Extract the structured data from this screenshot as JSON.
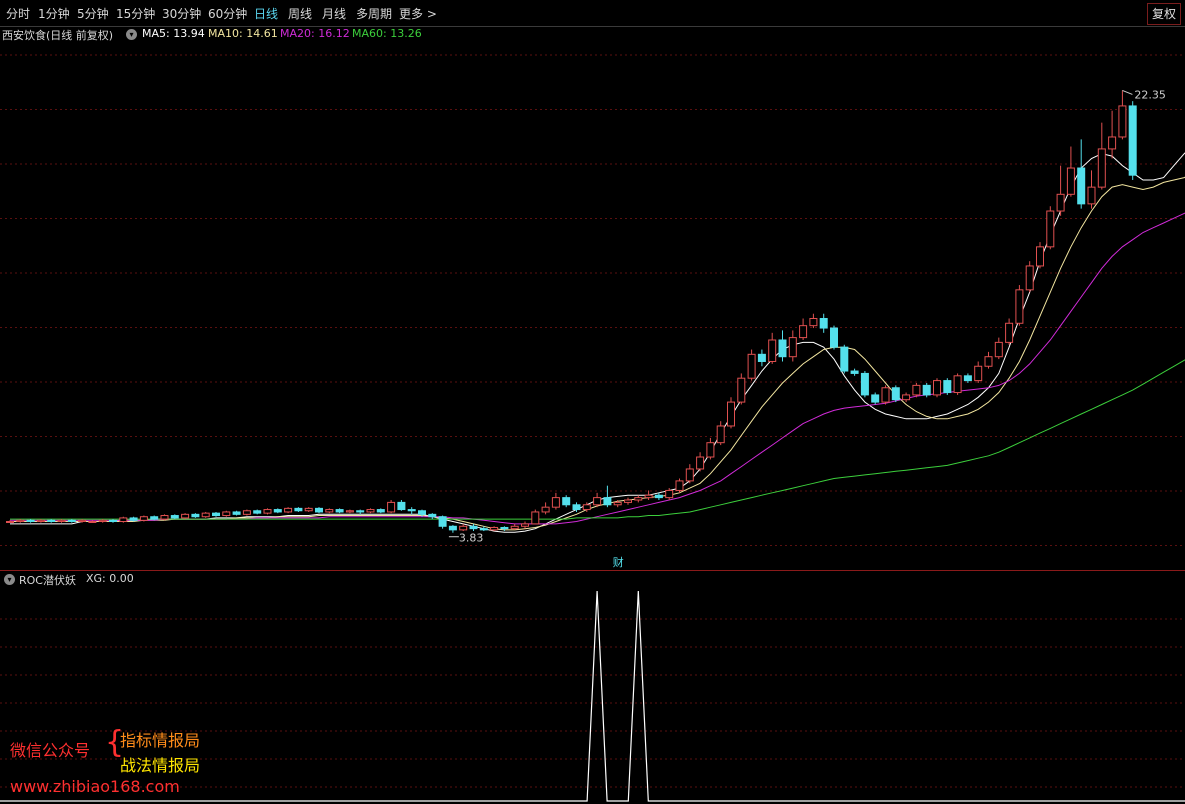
{
  "toolbar": {
    "tabs": [
      "分时",
      "1分钟",
      "5分钟",
      "15分钟",
      "30分钟",
      "60分钟",
      "日线",
      "周线",
      "月线",
      "多周期",
      "更多 >"
    ],
    "active_tab": "日线",
    "restore_label": "复权"
  },
  "infobar": {
    "stock": "西安饮食(日线 前复权)",
    "ma5": "MA5: 13.94",
    "ma10": "MA10: 14.61",
    "ma20": "MA20: 16.12",
    "ma60": "MA60: 13.26"
  },
  "colors": {
    "up": "#e05050",
    "down": "#54e0ec",
    "ma5": "#ffffff",
    "ma10": "#f3e6a0",
    "ma20": "#d02bd8",
    "ma60": "#3ccf3c",
    "grid": "#5a1010",
    "active_tab": "#5ad6f0"
  },
  "chart_data": {
    "type": "candlestick",
    "price_range": [
      3.4,
      24.0
    ],
    "high_label": "22.35",
    "low_label": "3.83",
    "event_marker": "财",
    "series": [
      {
        "name": "MA5",
        "values": [
          4.2,
          4.2,
          4.2,
          4.2,
          4.2,
          4.2,
          4.2,
          4.3,
          4.3,
          4.3,
          4.3,
          4.35,
          4.35,
          4.35,
          4.4,
          4.4,
          4.4,
          4.4,
          4.4,
          4.4,
          4.45,
          4.45,
          4.45,
          4.5,
          4.5,
          4.5,
          4.5,
          4.55,
          4.55,
          4.55,
          4.6,
          4.6,
          4.6,
          4.6,
          4.6,
          4.6,
          4.6,
          4.6,
          4.6,
          4.6,
          4.6,
          4.5,
          4.4,
          4.3,
          4.2,
          4.1,
          4.0,
          3.9,
          3.85,
          3.85,
          3.9,
          4.0,
          4.2,
          4.4,
          4.6,
          4.8,
          5.0,
          5.2,
          5.3,
          5.35,
          5.4,
          5.4,
          5.4,
          5.5,
          5.6,
          5.7,
          6.0,
          6.5,
          7.2,
          8.0,
          8.7,
          9.4,
          10.0,
          10.6,
          11.1,
          11.5,
          11.7,
          11.8,
          11.8,
          11.6,
          11.1,
          10.4,
          9.8,
          9.3,
          9.0,
          8.8,
          8.7,
          8.6,
          8.6,
          8.6,
          8.7,
          8.8,
          9.0,
          9.2,
          9.5,
          9.9,
          10.5,
          11.6,
          12.8,
          13.9,
          15.2,
          16.3,
          17.3,
          18.3,
          19.1,
          19.5,
          19.7,
          19.6,
          19.2,
          18.9,
          18.6,
          18.6,
          18.7,
          19.2,
          19.7,
          20.1
        ]
      },
      {
        "name": "MA10",
        "values": [
          4.3,
          4.3,
          4.3,
          4.3,
          4.3,
          4.3,
          4.3,
          4.3,
          4.3,
          4.3,
          4.3,
          4.3,
          4.3,
          4.35,
          4.35,
          4.35,
          4.4,
          4.4,
          4.4,
          4.4,
          4.4,
          4.4,
          4.45,
          4.45,
          4.45,
          4.45,
          4.5,
          4.5,
          4.5,
          4.5,
          4.55,
          4.55,
          4.55,
          4.55,
          4.55,
          4.55,
          4.55,
          4.55,
          4.55,
          4.55,
          4.55,
          4.5,
          4.45,
          4.4,
          4.3,
          4.2,
          4.1,
          4.0,
          3.95,
          3.95,
          4.0,
          4.05,
          4.15,
          4.3,
          4.45,
          4.6,
          4.8,
          4.95,
          5.05,
          5.15,
          5.2,
          5.25,
          5.3,
          5.35,
          5.4,
          5.5,
          5.7,
          5.9,
          6.3,
          6.8,
          7.3,
          7.9,
          8.5,
          9.1,
          9.6,
          10.1,
          10.5,
          10.9,
          11.2,
          11.5,
          11.6,
          11.6,
          11.5,
          11.1,
          10.6,
          10.1,
          9.6,
          9.2,
          8.9,
          8.7,
          8.6,
          8.6,
          8.7,
          8.8,
          9.0,
          9.3,
          9.7,
          10.3,
          11.0,
          11.9,
          12.9,
          13.9,
          14.9,
          15.8,
          16.6,
          17.3,
          17.9,
          18.3,
          18.4,
          18.3,
          18.2,
          18.3,
          18.5,
          18.6,
          18.7,
          18.9
        ]
      },
      {
        "name": "MA20",
        "values": [
          4.35,
          4.35,
          4.35,
          4.35,
          4.35,
          4.35,
          4.35,
          4.35,
          4.35,
          4.35,
          4.35,
          4.35,
          4.35,
          4.35,
          4.35,
          4.4,
          4.4,
          4.4,
          4.4,
          4.4,
          4.4,
          4.4,
          4.4,
          4.4,
          4.45,
          4.45,
          4.45,
          4.45,
          4.45,
          4.45,
          4.45,
          4.5,
          4.5,
          4.5,
          4.5,
          4.5,
          4.5,
          4.5,
          4.5,
          4.5,
          4.5,
          4.5,
          4.5,
          4.45,
          4.45,
          4.4,
          4.35,
          4.3,
          4.25,
          4.2,
          4.2,
          4.2,
          4.2,
          4.2,
          4.25,
          4.3,
          4.4,
          4.5,
          4.6,
          4.7,
          4.8,
          4.9,
          5.0,
          5.1,
          5.2,
          5.3,
          5.45,
          5.6,
          5.8,
          6.0,
          6.3,
          6.6,
          6.9,
          7.2,
          7.5,
          7.8,
          8.1,
          8.4,
          8.6,
          8.8,
          8.95,
          9.05,
          9.1,
          9.15,
          9.2,
          9.25,
          9.35,
          9.45,
          9.55,
          9.6,
          9.65,
          9.7,
          9.75,
          9.8,
          9.85,
          9.9,
          10.0,
          10.2,
          10.5,
          10.9,
          11.4,
          11.9,
          12.5,
          13.1,
          13.7,
          14.3,
          14.9,
          15.4,
          15.8,
          16.1,
          16.4,
          16.6,
          16.8,
          17.0,
          17.2,
          17.4
        ]
      },
      {
        "name": "MA60",
        "values": [
          4.4,
          4.4,
          4.4,
          4.4,
          4.4,
          4.4,
          4.4,
          4.4,
          4.4,
          4.4,
          4.4,
          4.4,
          4.4,
          4.4,
          4.4,
          4.4,
          4.4,
          4.4,
          4.4,
          4.4,
          4.4,
          4.4,
          4.4,
          4.4,
          4.4,
          4.4,
          4.4,
          4.4,
          4.4,
          4.4,
          4.4,
          4.4,
          4.4,
          4.4,
          4.4,
          4.4,
          4.4,
          4.4,
          4.4,
          4.4,
          4.4,
          4.4,
          4.4,
          4.4,
          4.4,
          4.4,
          4.4,
          4.4,
          4.4,
          4.4,
          4.4,
          4.4,
          4.4,
          4.4,
          4.4,
          4.45,
          4.45,
          4.45,
          4.45,
          4.45,
          4.5,
          4.5,
          4.55,
          4.55,
          4.6,
          4.65,
          4.7,
          4.8,
          4.9,
          5.0,
          5.1,
          5.2,
          5.3,
          5.4,
          5.5,
          5.6,
          5.7,
          5.8,
          5.9,
          6.0,
          6.1,
          6.15,
          6.2,
          6.25,
          6.3,
          6.35,
          6.4,
          6.45,
          6.5,
          6.55,
          6.6,
          6.65,
          6.75,
          6.85,
          6.95,
          7.05,
          7.2,
          7.4,
          7.6,
          7.8,
          8.0,
          8.2,
          8.4,
          8.6,
          8.8,
          9.0,
          9.2,
          9.4,
          9.6,
          9.8,
          10.05,
          10.3,
          10.55,
          10.8,
          11.05,
          11.3
        ]
      }
    ],
    "candles": [
      [
        4.3,
        4.3,
        4.35,
        4.25
      ],
      [
        4.3,
        4.35,
        4.4,
        4.25
      ],
      [
        4.35,
        4.3,
        4.4,
        4.25
      ],
      [
        4.3,
        4.35,
        4.4,
        4.25
      ],
      [
        4.35,
        4.3,
        4.4,
        4.25
      ],
      [
        4.3,
        4.35,
        4.4,
        4.25
      ],
      [
        4.35,
        4.3,
        4.4,
        4.25
      ],
      [
        4.3,
        4.35,
        4.4,
        4.25
      ],
      [
        4.3,
        4.3,
        4.35,
        4.25
      ],
      [
        4.3,
        4.35,
        4.4,
        4.25
      ],
      [
        4.35,
        4.3,
        4.4,
        4.25
      ],
      [
        4.3,
        4.45,
        4.5,
        4.25
      ],
      [
        4.45,
        4.35,
        4.5,
        4.3
      ],
      [
        4.35,
        4.5,
        4.55,
        4.3
      ],
      [
        4.5,
        4.4,
        4.55,
        4.35
      ],
      [
        4.4,
        4.55,
        4.6,
        4.35
      ],
      [
        4.55,
        4.45,
        4.6,
        4.4
      ],
      [
        4.45,
        4.6,
        4.65,
        4.4
      ],
      [
        4.6,
        4.5,
        4.65,
        4.45
      ],
      [
        4.5,
        4.65,
        4.7,
        4.45
      ],
      [
        4.65,
        4.55,
        4.7,
        4.5
      ],
      [
        4.55,
        4.7,
        4.75,
        4.5
      ],
      [
        4.7,
        4.6,
        4.75,
        4.55
      ],
      [
        4.6,
        4.75,
        4.8,
        4.55
      ],
      [
        4.75,
        4.65,
        4.8,
        4.6
      ],
      [
        4.65,
        4.8,
        4.85,
        4.6
      ],
      [
        4.8,
        4.7,
        4.85,
        4.65
      ],
      [
        4.7,
        4.85,
        4.9,
        4.65
      ],
      [
        4.85,
        4.75,
        4.9,
        4.7
      ],
      [
        4.75,
        4.85,
        4.9,
        4.7
      ],
      [
        4.85,
        4.7,
        4.9,
        4.65
      ],
      [
        4.7,
        4.8,
        4.85,
        4.65
      ],
      [
        4.8,
        4.7,
        4.85,
        4.65
      ],
      [
        4.7,
        4.75,
        4.8,
        4.65
      ],
      [
        4.75,
        4.7,
        4.8,
        4.6
      ],
      [
        4.7,
        4.8,
        4.85,
        4.65
      ],
      [
        4.8,
        4.7,
        4.85,
        4.65
      ],
      [
        4.7,
        5.1,
        5.2,
        4.65
      ],
      [
        5.1,
        4.8,
        5.2,
        4.75
      ],
      [
        4.8,
        4.75,
        4.9,
        4.6
      ],
      [
        4.75,
        4.6,
        4.8,
        4.5
      ],
      [
        4.6,
        4.5,
        4.65,
        4.4
      ],
      [
        4.5,
        4.1,
        4.55,
        4.0
      ],
      [
        4.1,
        3.95,
        4.15,
        3.83
      ],
      [
        3.95,
        4.1,
        4.2,
        3.9
      ],
      [
        4.1,
        4.0,
        4.2,
        3.9
      ],
      [
        4.0,
        3.95,
        4.1,
        3.9
      ],
      [
        3.95,
        4.05,
        4.1,
        3.9
      ],
      [
        4.05,
        4.0,
        4.1,
        3.9
      ],
      [
        4.0,
        4.1,
        4.2,
        3.95
      ],
      [
        4.1,
        4.2,
        4.3,
        4.0
      ],
      [
        4.2,
        4.7,
        4.8,
        4.2
      ],
      [
        4.7,
        4.9,
        5.1,
        4.6
      ],
      [
        4.9,
        5.3,
        5.5,
        4.8
      ],
      [
        5.3,
        5.0,
        5.4,
        4.9
      ],
      [
        5.0,
        4.8,
        5.1,
        4.7
      ],
      [
        4.8,
        5.0,
        5.1,
        4.7
      ],
      [
        5.0,
        5.3,
        5.5,
        4.9
      ],
      [
        5.3,
        5.0,
        5.8,
        4.9
      ],
      [
        5.0,
        5.1,
        5.2,
        4.9
      ],
      [
        5.1,
        5.2,
        5.3,
        5.0
      ],
      [
        5.2,
        5.3,
        5.4,
        5.1
      ],
      [
        5.3,
        5.4,
        5.6,
        5.2
      ],
      [
        5.4,
        5.3,
        5.5,
        5.2
      ],
      [
        5.3,
        5.6,
        5.7,
        5.2
      ],
      [
        5.6,
        6.0,
        6.1,
        5.5
      ],
      [
        6.0,
        6.5,
        6.7,
        5.9
      ],
      [
        6.5,
        7.0,
        7.2,
        6.4
      ],
      [
        7.0,
        7.6,
        7.8,
        6.9
      ],
      [
        7.6,
        8.3,
        8.5,
        7.5
      ],
      [
        8.3,
        9.3,
        9.5,
        8.2
      ],
      [
        9.3,
        10.3,
        10.5,
        9.2
      ],
      [
        10.3,
        11.3,
        11.5,
        10.2
      ],
      [
        11.3,
        11.0,
        11.5,
        10.8
      ],
      [
        11.0,
        11.9,
        12.2,
        10.9
      ],
      [
        11.9,
        11.2,
        12.3,
        11.0
      ],
      [
        11.2,
        12.0,
        12.3,
        11.0
      ],
      [
        12.0,
        12.5,
        12.8,
        11.9
      ],
      [
        12.5,
        12.8,
        13.0,
        12.4
      ],
      [
        12.8,
        12.4,
        13.0,
        12.2
      ],
      [
        12.4,
        11.6,
        12.5,
        11.5
      ],
      [
        11.6,
        10.6,
        11.7,
        10.5
      ],
      [
        10.6,
        10.5,
        10.7,
        10.4
      ],
      [
        10.5,
        9.6,
        10.6,
        9.5
      ],
      [
        9.6,
        9.3,
        9.7,
        9.2
      ],
      [
        9.3,
        9.9,
        10.0,
        9.2
      ],
      [
        9.9,
        9.4,
        10.0,
        9.3
      ],
      [
        9.4,
        9.6,
        9.7,
        9.3
      ],
      [
        9.6,
        10.0,
        10.1,
        9.5
      ],
      [
        10.0,
        9.6,
        10.1,
        9.5
      ],
      [
        9.6,
        10.2,
        10.3,
        9.5
      ],
      [
        10.2,
        9.7,
        10.3,
        9.6
      ],
      [
        9.7,
        10.4,
        10.5,
        9.6
      ],
      [
        10.4,
        10.2,
        10.5,
        10.1
      ],
      [
        10.2,
        10.8,
        11.0,
        10.1
      ],
      [
        10.8,
        11.2,
        11.4,
        10.7
      ],
      [
        11.2,
        11.8,
        12.0,
        11.1
      ],
      [
        11.8,
        12.6,
        12.8,
        11.7
      ],
      [
        12.6,
        14.0,
        14.2,
        12.5
      ],
      [
        14.0,
        15.0,
        15.2,
        13.9
      ],
      [
        15.0,
        15.8,
        16.0,
        14.9
      ],
      [
        15.8,
        17.3,
        17.5,
        15.7
      ],
      [
        17.3,
        18.0,
        19.2,
        17.1
      ],
      [
        18.0,
        19.1,
        20.0,
        17.9
      ],
      [
        19.1,
        17.6,
        20.3,
        17.4
      ],
      [
        17.6,
        18.3,
        19.0,
        17.4
      ],
      [
        18.3,
        19.9,
        21.0,
        18.2
      ],
      [
        19.9,
        20.4,
        21.5,
        19.5
      ],
      [
        20.4,
        21.7,
        22.35,
        20.3
      ],
      [
        21.7,
        18.8,
        21.9,
        18.6
      ]
    ]
  },
  "indicator": {
    "label": "ROC潜伏妖",
    "xg": "XG: 0.00",
    "chart_data": {
      "type": "line",
      "name": "XG",
      "peaks_at_candle_index": [
        57,
        61
      ],
      "ylim": [
        0,
        1
      ]
    }
  },
  "watermark": {
    "wechat": "微信公众号",
    "line1": "指标情报局",
    "line2": "战法情报局",
    "url": "www.zhibiao168.com"
  }
}
